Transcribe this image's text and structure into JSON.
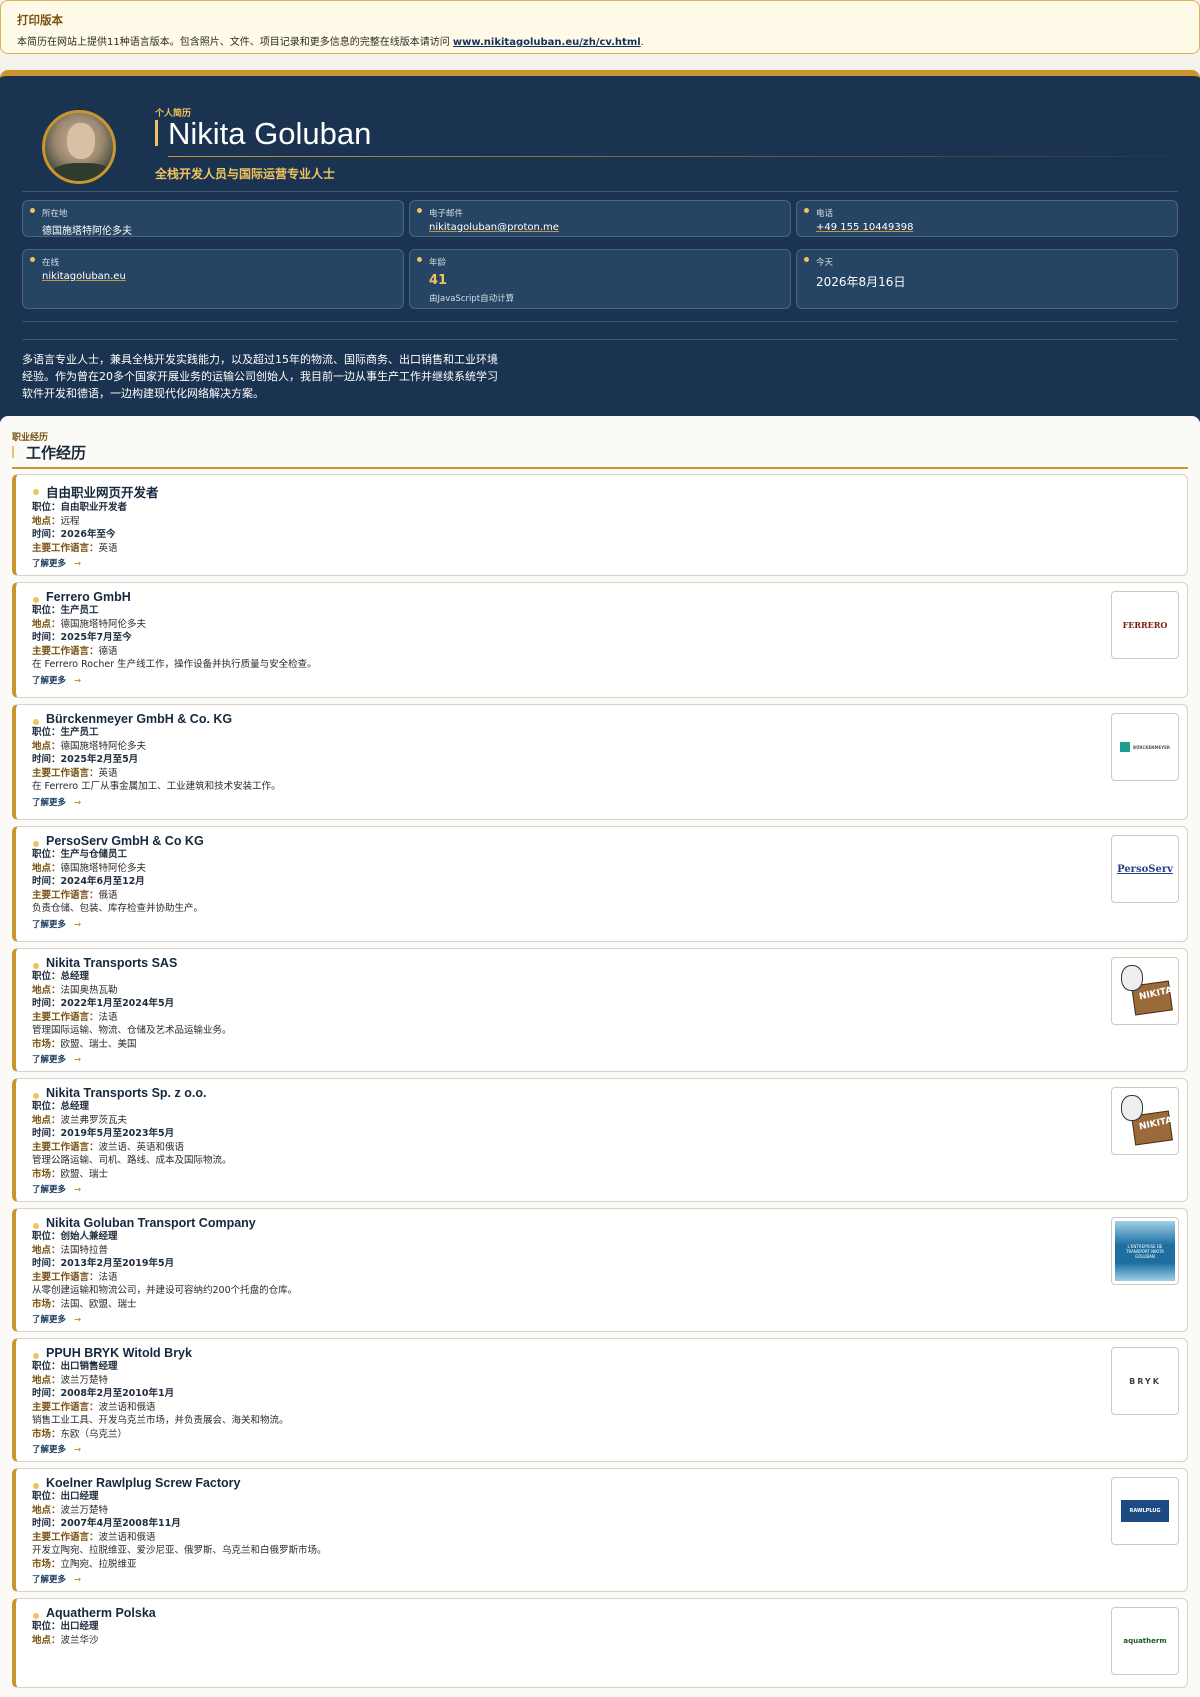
{
  "print_banner": {
    "title": "打印版本",
    "text": "本简历在网站上提供11种语言版本。包含照片、文件、项目记录和更多信息的完整在线版本请访问",
    "link": "www.nikitagoluban.eu/zh/cv.html",
    "suffix": "."
  },
  "header": {
    "eyebrow": "个人简历",
    "name": "Nikita Goluban",
    "subtitle": "全栈开发人员与国际运营专业人士",
    "location_label": "所在地",
    "location_value": "德国施塔特阿伦多夫",
    "email_label": "电子邮件",
    "email_value": "nikitagoluban@proton.me",
    "phone_label": "电话",
    "phone_value": "+49 155 10449398",
    "online_label": "在线",
    "online_value": "nikitagoluban.eu",
    "age_label": "年龄",
    "age_value": "41",
    "age_note": "由JavaScript自动计算",
    "today_label": "今天",
    "today_value": "2026年8月16日",
    "summary": "多语言专业人士，兼具全栈开发实践能力，以及超过15年的物流、国际商务、出口销售和工业环境经验。作为曾在20多个国家开展业务的运输公司创始人，我目前一边从事生产工作并继续系统学习软件开发和德语，一边构建现代化网络解决方案。"
  },
  "experience": {
    "eyebrow": "职业经历",
    "title": "工作经历",
    "more_label": "了解更多",
    "more_arrow": "→",
    "labels": {
      "role": "职位：",
      "location": "地点：",
      "period": "时间：",
      "language": "主要工作语言：",
      "market": "市场："
    },
    "jobs": [
      {
        "company": "自由职业网页开发者",
        "role": "自由职业开发者",
        "location": "远程",
        "period": "2026年至今",
        "language": "英语",
        "desc": "",
        "market": ""
      },
      {
        "company": "Ferrero GmbH",
        "role": "生产员工",
        "location": "德国施塔特阿伦多夫",
        "period": "2025年7月至今",
        "language": "德语",
        "desc": "在 Ferrero Rocher 生产线工作，操作设备并执行质量与安全检查。",
        "market": "",
        "logo": "FERRERO"
      },
      {
        "company": "Bürckenmeyer GmbH & Co. KG",
        "role": "生产员工",
        "location": "德国施塔特阿伦多夫",
        "period": "2025年2月至5月",
        "language": "英语",
        "desc": "在 Ferrero 工厂从事金属加工、工业建筑和技术安装工作。",
        "market": "",
        "logo": "BÜRCKENMEYER"
      },
      {
        "company": "PersoServ GmbH & Co KG",
        "role": "生产与仓储员工",
        "location": "德国施塔特阿伦多夫",
        "period": "2024年6月至12月",
        "language": "俄语",
        "desc": "负责仓储、包装、库存检查并协助生产。",
        "market": "",
        "logo": "PersoServ"
      },
      {
        "company": "Nikita Transports SAS",
        "role": "总经理",
        "location": "法国奥热瓦勒",
        "period": "2022年1月至2024年5月",
        "language": "法语",
        "desc": "管理国际运输、物流、仓储及艺术品运输业务。",
        "market": "欧盟、瑞士、美国",
        "logo": "NIKITA"
      },
      {
        "company": "Nikita Transports Sp. z o.o.",
        "role": "总经理",
        "location": "波兰弗罗茨瓦夫",
        "period": "2019年5月至2023年5月",
        "language": "波兰语、英语和俄语",
        "desc": "管理公路运输、司机、路线、成本及国际物流。",
        "market": "欧盟、瑞士",
        "logo": "NIKITA"
      },
      {
        "company": "Nikita Goluban Transport Company",
        "role": "创始人兼经理",
        "location": "法国特拉普",
        "period": "2013年2月至2019年5月",
        "language": "法语",
        "desc": "从零创建运输和物流公司，并建设可容纳约200个托盘的仓库。",
        "market": "法国、欧盟、瑞士",
        "logo": "L'ENTREPRISE DE TRANSPORT NIKITA GOLUBAN"
      },
      {
        "company": "PPUH BRYK Witold Bryk",
        "role": "出口销售经理",
        "location": "波兰万楚特",
        "period": "2008年2月至2010年1月",
        "language": "波兰语和俄语",
        "desc": "销售工业工具、开发乌克兰市场，并负责展会、海关和物流。",
        "market": "东欧（乌克兰）",
        "logo": "BRYK"
      },
      {
        "company": "Koelner Rawlplug Screw Factory",
        "role": "出口经理",
        "location": "波兰万楚特",
        "period": "2007年4月至2008年11月",
        "language": "波兰语和俄语",
        "desc": "开发立陶宛、拉脱维亚、爱沙尼亚、俄罗斯、乌克兰和白俄罗斯市场。",
        "market": "立陶宛、拉脱维亚",
        "logo": "RAWLPLUG"
      },
      {
        "company": "Aquatherm Polska",
        "role": "出口经理",
        "location": "波兰华沙",
        "period": "",
        "language": "",
        "desc": "",
        "market": "",
        "logo": "aquatherm"
      }
    ]
  },
  "colors": {
    "navy": "#1a3350",
    "gold": "#c9952f",
    "gold_light": "#f0c35f",
    "paper": "#fbfaf7"
  }
}
